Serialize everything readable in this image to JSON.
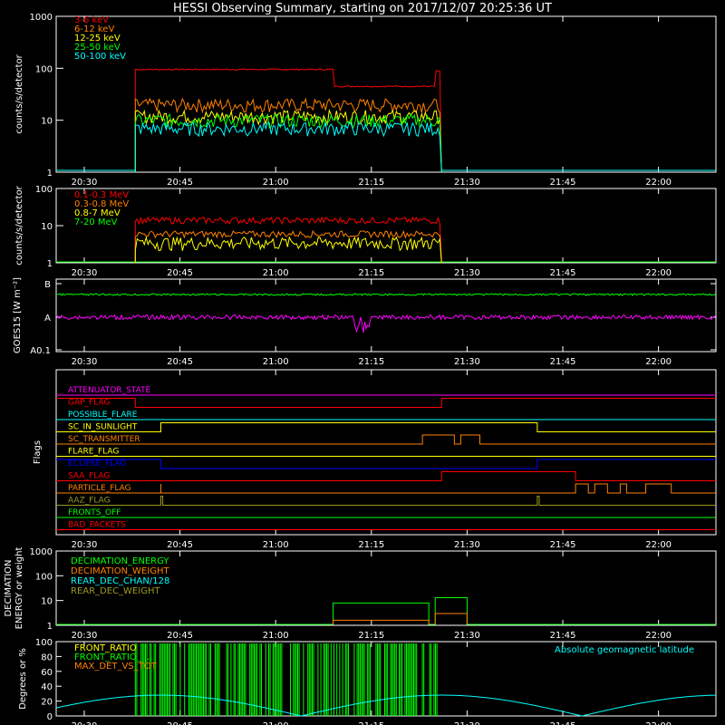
{
  "title": "HESSI Observing Summary, starting on 2017/12/07 20:25:36 UT",
  "time_ticks": [
    "20:30",
    "20:45",
    "21:00",
    "21:15",
    "21:30",
    "21:45",
    "22:00"
  ],
  "colors": {
    "red": "#ff0000",
    "orange": "#ff8000",
    "yellow": "#ffff00",
    "green": "#00ff00",
    "cyan": "#00ffff",
    "magenta": "#ff00ff",
    "blue": "#0000ff",
    "purple": "#b000ff",
    "olive": "#9a9a20",
    "brown": "#c08030",
    "white": "#ffffff"
  },
  "chart_data": [
    {
      "type": "line",
      "name": "count_rates_low",
      "ylabel": "counts/s/detector",
      "yscale": "log",
      "ylim": [
        1,
        1000
      ],
      "y_ticks": [
        "1",
        "10",
        "100",
        "1000"
      ],
      "xlim": [
        "20:25:36",
        "22:09:00"
      ],
      "series": [
        {
          "name": "3-6 keV",
          "color": "#ff0000",
          "segments": [
            [
              "20:38",
              "20:38",
              1
            ],
            [
              "20:38",
              "21:09",
              95
            ],
            [
              "21:09",
              "21:25",
              45
            ],
            [
              "21:25",
              "21:26",
              88
            ]
          ]
        },
        {
          "name": "6-12 keV",
          "color": "#ff8000",
          "level": 20
        },
        {
          "name": "12-25 keV",
          "color": "#ffff00",
          "level": 12
        },
        {
          "name": "25-50 keV",
          "color": "#00ff00",
          "level": 10
        },
        {
          "name": "50-100 keV",
          "color": "#00ffff",
          "level": 7
        }
      ],
      "active_range": [
        "20:38",
        "21:26"
      ]
    },
    {
      "type": "line",
      "name": "count_rates_high",
      "ylabel": "counts/s/detector",
      "yscale": "log",
      "ylim": [
        1,
        100
      ],
      "y_ticks": [
        "1",
        "10",
        "100"
      ],
      "series": [
        {
          "name": "0.1-0.3 MeV",
          "color": "#ff0000",
          "level": 14
        },
        {
          "name": "0.3-0.8 MeV",
          "color": "#ff8000",
          "level": 6
        },
        {
          "name": "0.8-7 MeV",
          "color": "#ffff00",
          "level": 3.5
        },
        {
          "name": "7-20 MeV",
          "color": "#00ff00",
          "level": 1
        }
      ],
      "active_range": [
        "20:38",
        "21:26"
      ]
    },
    {
      "type": "line",
      "name": "goes",
      "ylabel": "GOES15 [W m⁻²]",
      "y_ticks": [
        "A0.1",
        "A",
        "B"
      ],
      "series": [
        {
          "name": "GOES long",
          "color": "#00ff00",
          "level": "upper"
        },
        {
          "name": "GOES short",
          "color": "#ff00ff",
          "level": "middle"
        }
      ]
    },
    {
      "type": "line",
      "name": "flags",
      "ylabel": "Flags",
      "series": [
        {
          "name": "ATTENUATOR_STATE",
          "color": "#ff00ff"
        },
        {
          "name": "GAP_FLAG",
          "color": "#ff0000"
        },
        {
          "name": "POSSIBLE_FLARE",
          "color": "#00ffff"
        },
        {
          "name": "SC_IN_SUNLIGHT",
          "color": "#ffff00"
        },
        {
          "name": "SC_TRANSMITTER",
          "color": "#ff8000"
        },
        {
          "name": "FLARE_FLAG",
          "color": "#ffff00"
        },
        {
          "name": "ECLIPSE_FLAG",
          "color": "#0000ff"
        },
        {
          "name": "SAA_FLAG",
          "color": "#ff0000"
        },
        {
          "name": "PARTICLE_FLAG",
          "color": "#ff8000"
        },
        {
          "name": "AAZ_FLAG",
          "color": "#9a9a20"
        },
        {
          "name": "FRONTS_OFF",
          "color": "#00ff00"
        },
        {
          "name": "BAD_PACKETS",
          "color": "#ff0000"
        }
      ]
    },
    {
      "type": "line",
      "name": "decimation",
      "ylabel": "DECIMATION ENERGY or weight",
      "yscale": "log",
      "ylim": [
        1,
        1000
      ],
      "y_ticks": [
        "1",
        "10",
        "100",
        "1000"
      ],
      "series": [
        {
          "name": "DECIMATION_ENERGY",
          "color": "#00ff00"
        },
        {
          "name": "DECIMATION_WEIGHT",
          "color": "#ff8000"
        },
        {
          "name": "REAR_DEC_CHAN/128",
          "color": "#00ffff"
        },
        {
          "name": "REAR_DEC_WEIGHT",
          "color": "#9a9a20"
        }
      ]
    },
    {
      "type": "line",
      "name": "geo",
      "ylabel": "Degrees or %",
      "ylim": [
        0,
        100
      ],
      "y_ticks": [
        "0",
        "20",
        "40",
        "60",
        "80",
        "100"
      ],
      "series": [
        {
          "name": "FRONT_RATIO",
          "color": "#ffff00"
        },
        {
          "name": "FRONT_RATIO_ ...",
          "color": "#00ff00"
        },
        {
          "name": "MAX_DET_VS_TOT",
          "color": "#ff8000"
        },
        {
          "name": "Absolute geomagnetic latitude",
          "color": "#00ffff"
        }
      ]
    }
  ]
}
